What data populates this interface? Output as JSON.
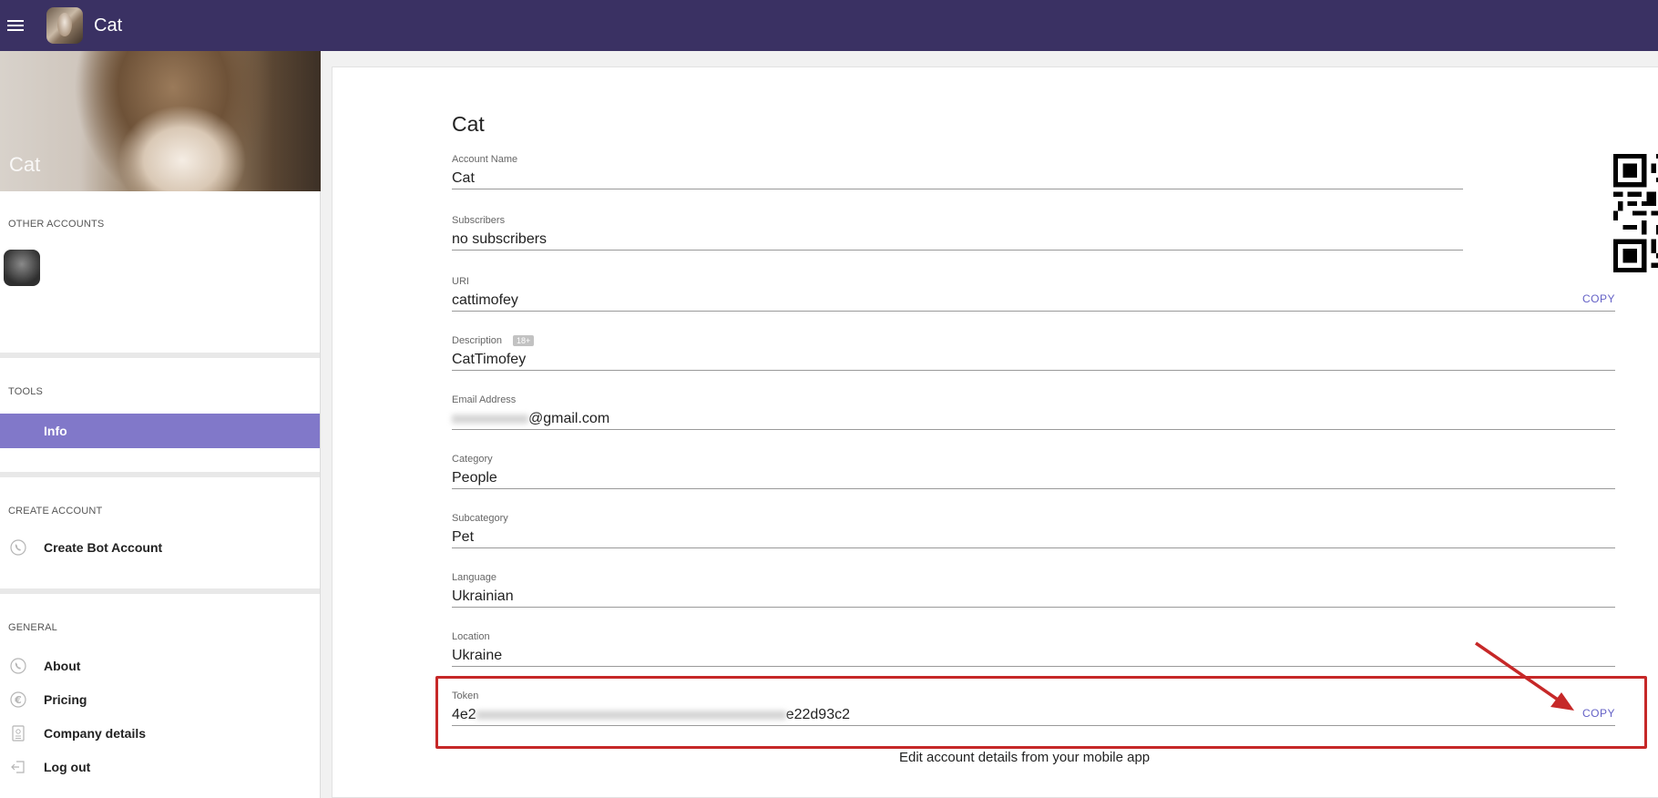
{
  "header": {
    "menu_icon": "hamburger-icon",
    "title": "Cat"
  },
  "sidebar": {
    "cover_name": "Cat",
    "other_accounts_label": "OTHER ACCOUNTS",
    "tools_label": "TOOLS",
    "tools_items": [
      {
        "label": "Info",
        "active": true
      }
    ],
    "create_label": "CREATE ACCOUNT",
    "create_items": [
      {
        "label": "Create Bot Account",
        "icon": "viber-icon"
      }
    ],
    "general_label": "GENERAL",
    "general_items": [
      {
        "label": "About",
        "icon": "viber-icon"
      },
      {
        "label": "Pricing",
        "icon": "euro-icon"
      },
      {
        "label": "Company details",
        "icon": "id-card-icon"
      },
      {
        "label": "Log out",
        "icon": "logout-icon"
      }
    ]
  },
  "main": {
    "heading": "Cat",
    "fields": {
      "account_name": {
        "label": "Account Name",
        "value": "Cat"
      },
      "subscribers": {
        "label": "Subscribers",
        "value": "no subscribers"
      },
      "uri": {
        "label": "URI",
        "value": "cattimofey",
        "copy": "COPY"
      },
      "description": {
        "label": "Description",
        "badge": "18+",
        "value": "CatTimofey"
      },
      "email": {
        "label": "Email Address",
        "value_visible": "@gmail.com"
      },
      "category": {
        "label": "Category",
        "value": "People"
      },
      "subcategory": {
        "label": "Subcategory",
        "value": "Pet"
      },
      "language": {
        "label": "Language",
        "value": "Ukrainian"
      },
      "location": {
        "label": "Location",
        "value": "Ukraine"
      },
      "token": {
        "label": "Token",
        "value_start": "4e2",
        "value_end": "e22d93c2",
        "copy": "COPY"
      }
    },
    "footer_note": "Edit account details from your mobile app"
  },
  "colors": {
    "header_bg": "#3a3163",
    "nav_active_bg": "#8178c9",
    "copy_link": "#6461c6",
    "highlight": "#c62828"
  }
}
